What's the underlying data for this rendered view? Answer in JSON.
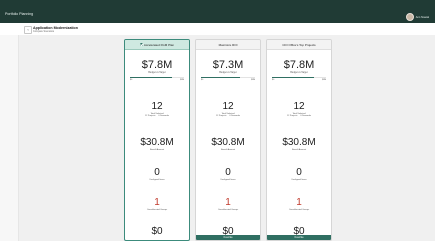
{
  "app": {
    "title": "Portfolio Planning",
    "user_name": "Ann Nowak"
  },
  "header": {
    "title": "Application Modernization",
    "subtitle": "Compare Scenarios"
  },
  "scenarios": [
    {
      "name": "Accelerated FGM Plan",
      "selected": true,
      "budget": "$7.8M",
      "budget_label": "Budget vs Target",
      "progress_fraction": 0.78,
      "scale_min": "$0",
      "scale_max": "$8M",
      "total_selected": "12",
      "total_selected_label": "Total Selected",
      "projects": "12 Projects",
      "demands": "0 Demands",
      "benefit": "$30.8M",
      "benefit_label": "Benefit Amount",
      "unaligned": "0",
      "unaligned_label": "Unaligned Items",
      "overallocated": "1",
      "overallocated_label": "Overallocated Groups",
      "partial_value": "$0",
      "override_label": ""
    },
    {
      "name": "Maximize ROI",
      "selected": false,
      "budget": "$7.3M",
      "budget_label": "Budget vs Target",
      "progress_fraction": 0.73,
      "scale_min": "$0",
      "scale_max": "$8M",
      "total_selected": "12",
      "total_selected_label": "Total Selected",
      "projects": "12 Projects",
      "demands": "0 Demands",
      "benefit": "$30.8M",
      "benefit_label": "Benefit Amount",
      "unaligned": "0",
      "unaligned_label": "Unaligned Items",
      "overallocated": "1",
      "overallocated_label": "Overallocated Groups",
      "partial_value": "$0",
      "override_label": "Override"
    },
    {
      "name": "CIO Office's Top Projects",
      "selected": false,
      "budget": "$7.8M",
      "budget_label": "Budget vs Target",
      "progress_fraction": 0.78,
      "scale_min": "$0",
      "scale_max": "$8M",
      "total_selected": "12",
      "total_selected_label": "Total Selected",
      "projects": "12 Projects",
      "demands": "0 Demands",
      "benefit": "$30.8M",
      "benefit_label": "Benefit Amount",
      "unaligned": "0",
      "unaligned_label": "Unaligned Items",
      "overallocated": "1",
      "overallocated_label": "Overallocated Groups",
      "partial_value": "$0",
      "override_label": "Override"
    }
  ]
}
